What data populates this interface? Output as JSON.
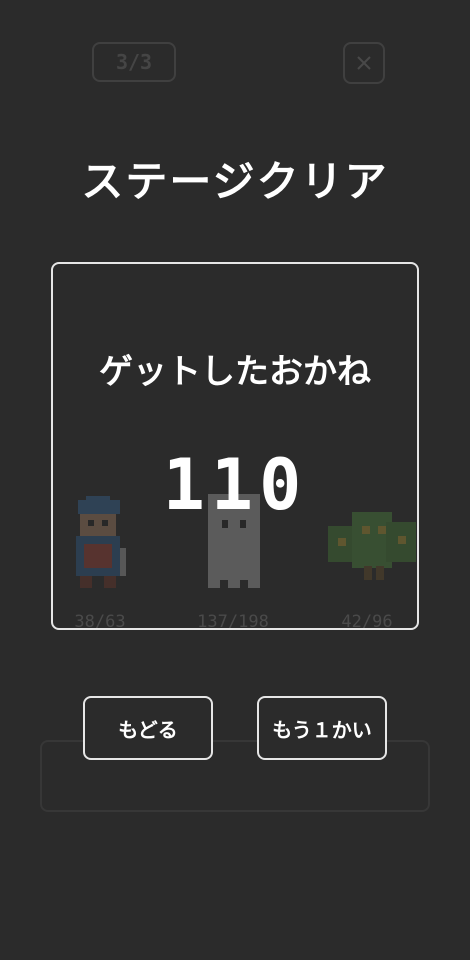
{
  "header": {
    "stage_progress": "3/3",
    "close_symbol": "×"
  },
  "title": "ステージクリア",
  "result": {
    "label": "ゲットしたおかね",
    "amount": "110"
  },
  "characters": [
    {
      "name": "knight",
      "count": "38/63"
    },
    {
      "name": "ghost",
      "count": "137/198"
    },
    {
      "name": "tree-monster",
      "count": "42/96"
    }
  ],
  "buttons": {
    "back": "もどる",
    "retry": "もう１かい"
  },
  "colors": {
    "background": "#2b2b2b",
    "text": "#ffffff",
    "border": "#e6e6e6"
  }
}
